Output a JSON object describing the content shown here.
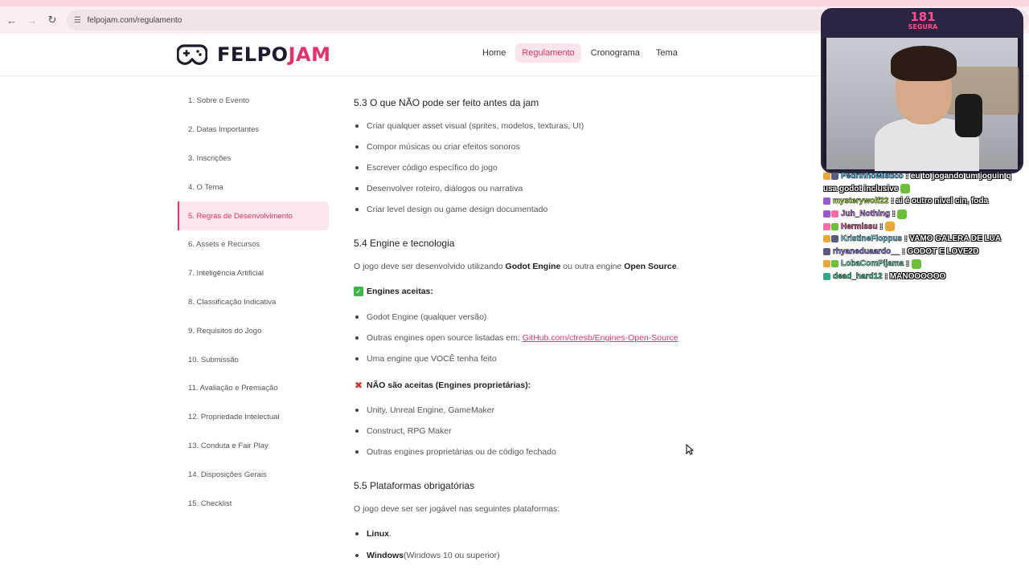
{
  "browser": {
    "url": "felpojam.com/regulamento"
  },
  "header": {
    "logo_prefix": "FELPO",
    "logo_suffix": "JAM",
    "nav": [
      "Home",
      "Regulamento",
      "Cronograma",
      "Tema"
    ],
    "active_nav": "Regulamento"
  },
  "sidebar": {
    "items": [
      "1. Sobre o Evento",
      "2. Datas Importantes",
      "3. Inscrições",
      "4. O Tema",
      "5. Regras de Desenvolvimento",
      "6. Assets e Recursos",
      "7. Inteligência Artificial",
      "8. Classificação Indicativa",
      "9. Requisitos do Jogo",
      "10. Submissão",
      "11. Avaliação e Premiação",
      "12. Propriedade Intelectual",
      "13. Conduta e Fair Play",
      "14. Disposições Gerais",
      "15. Checklist"
    ],
    "active_index": 4
  },
  "content": {
    "s53_title": "5.3 O que NÃO pode ser feito antes da jam",
    "s53_items": [
      "Criar qualquer asset visual (sprites, modelos, texturas, UI)",
      "Compor músicas ou criar efeitos sonoros",
      "Escrever código específico do jogo",
      "Desenvolver roteiro, diálogos ou narrativa",
      "Criar level design ou game design documentado"
    ],
    "s54_title": "5.4 Engine e tecnologia",
    "s54_intro_a": "O jogo deve ser desenvolvido utilizando ",
    "s54_intro_b": "Godot Engine",
    "s54_intro_c": " ou outra engine ",
    "s54_intro_d": "Open Source",
    "s54_intro_e": ".",
    "accepted_label": "Engines aceitas:",
    "accepted_item1": "Godot Engine (qualquer versão)",
    "accepted_item2_prefix": "Outras engines open source listadas em: ",
    "accepted_item2_link": "GitHub.com/ctresb/Engines-Open-Source",
    "accepted_item3": "Uma engine que VOCÊ tenha feito",
    "rejected_label": "NÃO são aceitas (Engines proprietárias):",
    "rejected_items": [
      "Unity, Unreal Engine, GameMaker",
      "Construct, RPG Maker",
      "Outras engines proprietárias ou de código fechado"
    ],
    "s55_title": "5.5 Plataformas obrigatórias",
    "s55_intro": "O jogo deve ser ser jogável nas seguintes plataformas:",
    "platform1": "Linux",
    "platform1_suffix": ".",
    "platform2": "Windows",
    "platform2_suffix": " (Windows 10 ou superior)"
  },
  "stream": {
    "badge_number": "181",
    "badge_label": "SEGURA",
    "chat": [
      {
        "user": "PedrinhoMistico",
        "color": "#4ec9ff",
        "msg": ": eu to jogando um joguin q"
      },
      {
        "user": "",
        "color": "#ffffff",
        "msg": "usa godot inclusive"
      },
      {
        "user": "mysterywolf22",
        "color": "#c4ff4d",
        "msg": ": ai é outro nivel cin, foda"
      },
      {
        "user": "Juh_Nothing",
        "color": "#d08cff",
        "msg": ":"
      },
      {
        "user": "Hermissu",
        "color": "#ff6aa8",
        "msg": ":"
      },
      {
        "user": "KristineFloppus",
        "color": "#7ee8ff",
        "msg": ": VAMO GALERA DE LUA"
      },
      {
        "user": "rhyaneduaardo__",
        "color": "#9b8cff",
        "msg": ": GODOT E LOVE2D"
      },
      {
        "user": "LobaComPijama",
        "color": "#7ef0d0",
        "msg": ":"
      },
      {
        "user": "dead_hard12",
        "color": "#4ee0a0",
        "msg": ": MANOOOOOO"
      }
    ]
  }
}
